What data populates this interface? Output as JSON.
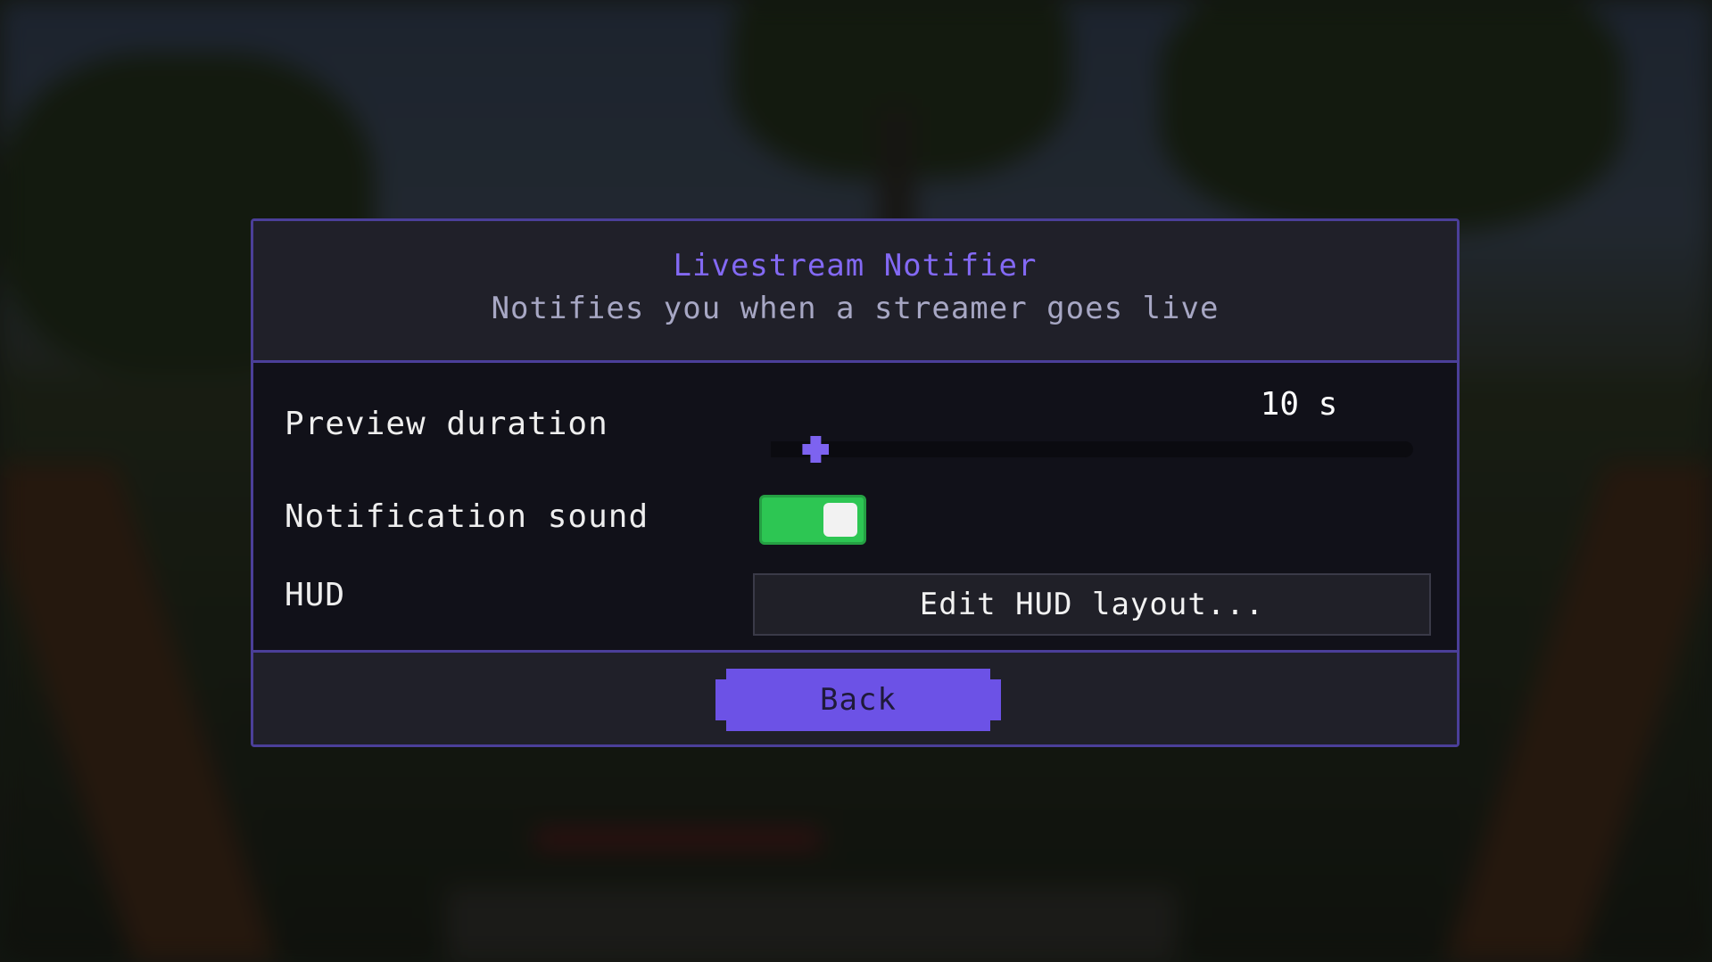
{
  "dialog": {
    "title": "Livestream Notifier",
    "subtitle": "Notifies you when a streamer goes live"
  },
  "settings": {
    "preview_duration": {
      "label": "Preview duration",
      "value_text": "10 s",
      "slider_fraction": 0.07
    },
    "notification_sound": {
      "label": "Notification sound",
      "enabled": true
    },
    "hud": {
      "label": "HUD",
      "button_label": "Edit HUD layout..."
    }
  },
  "footer": {
    "back_label": "Back"
  },
  "colors": {
    "accent": "#6c52e6",
    "title": "#8369f4",
    "toggle_on": "#2dc653",
    "border": "#4b3f99"
  }
}
